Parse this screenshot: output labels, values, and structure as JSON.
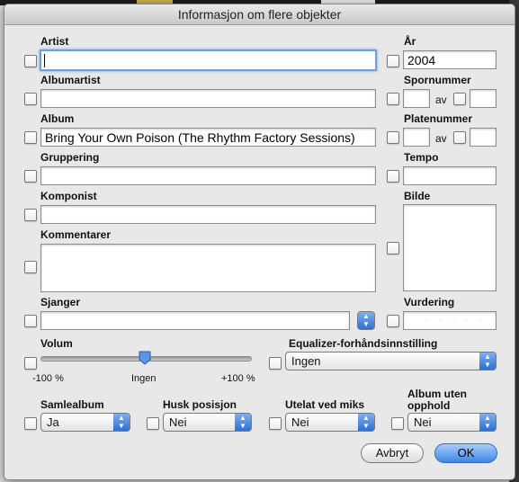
{
  "window": {
    "title": "Informasjon om flere objekter"
  },
  "fields": {
    "artist": {
      "label": "Artist",
      "value": ""
    },
    "year": {
      "label": "År",
      "value": "2004"
    },
    "album_artist": {
      "label": "Albumartist",
      "value": ""
    },
    "track_number": {
      "label": "Spornummer",
      "of": "av"
    },
    "album": {
      "label": "Album",
      "value": "Bring Your Own Poison (The Rhythm Factory Sessions)"
    },
    "disc_number": {
      "label": "Platenummer",
      "of": "av"
    },
    "grouping": {
      "label": "Gruppering",
      "value": ""
    },
    "tempo": {
      "label": "Tempo",
      "value": ""
    },
    "composer": {
      "label": "Komponist",
      "value": ""
    },
    "artwork": {
      "label": "Bilde"
    },
    "comments": {
      "label": "Kommentarer",
      "value": ""
    },
    "genre": {
      "label": "Sjanger",
      "value": ""
    },
    "rating": {
      "label": "Vurdering",
      "value": "· · · · ·"
    },
    "volume": {
      "label": "Volum",
      "min_label": "-100 %",
      "mid_label": "Ingen",
      "max_label": "+100 %",
      "level_percent": 0
    },
    "equalizer": {
      "label": "Equalizer-forhåndsinnstilling",
      "value": "Ingen"
    },
    "compilation": {
      "label": "Samlealbum",
      "value": "Ja"
    },
    "remember_position": {
      "label": "Husk posisjon",
      "value": "Nei"
    },
    "skip_shuffle": {
      "label": "Utelat ved miks",
      "value": "Nei"
    },
    "gapless": {
      "label_line1": "Album uten",
      "label_line2": "opphold",
      "value": "Nei"
    }
  },
  "buttons": {
    "cancel": "Avbryt",
    "ok": "OK"
  },
  "colors": {
    "accent": "#3e86e6",
    "focus_ring": "#6aa0e8",
    "dialog_bg": "#e8e8e8"
  }
}
